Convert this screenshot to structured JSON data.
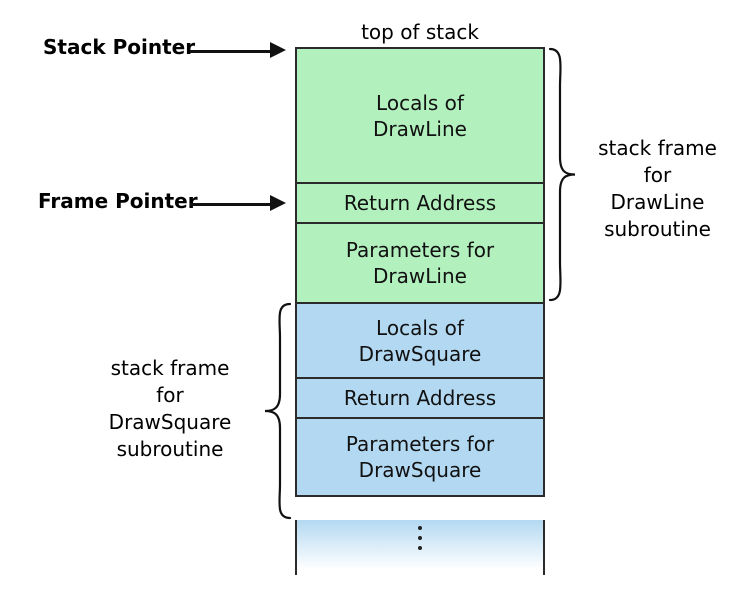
{
  "top_label": "top of stack",
  "pointers": {
    "stack_pointer": "Stack Pointer",
    "frame_pointer": "Frame Pointer"
  },
  "frames": {
    "drawline": {
      "locals": "Locals of\nDrawLine",
      "return_addr": "Return Address",
      "params": "Parameters for\nDrawLine",
      "caption_line1": "stack frame",
      "caption_line2": "for",
      "caption_line3": "DrawLine",
      "caption_line4": "subroutine"
    },
    "drawsquare": {
      "locals": "Locals of\nDrawSquare",
      "return_addr": "Return Address",
      "params": "Parameters for\nDrawSquare",
      "caption_line1": "stack frame",
      "caption_line2": "for",
      "caption_line3": "DrawSquare",
      "caption_line4": "subroutine"
    }
  },
  "colors": {
    "green": "#b2f0be",
    "blue": "#b3d9f2"
  }
}
